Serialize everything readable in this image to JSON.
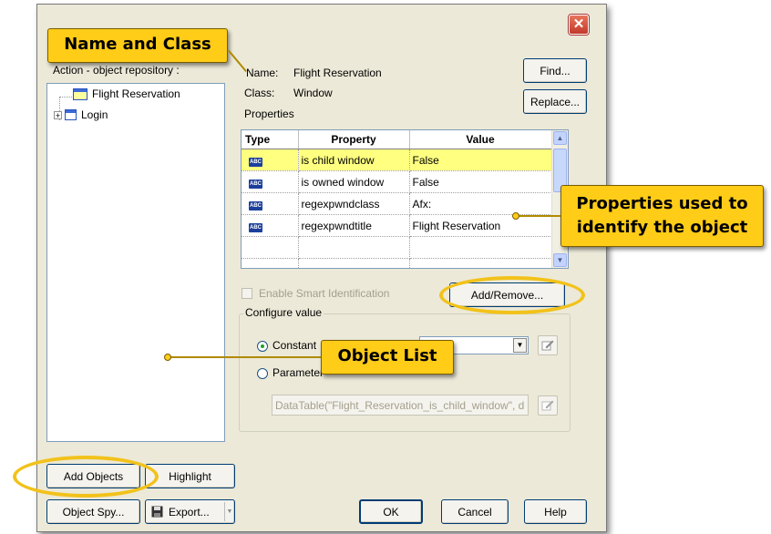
{
  "dialog": {
    "close_glyph": "✕",
    "action_label": "Action - object repository :",
    "name_label": "Name:",
    "name_value": "Flight Reservation",
    "class_label": "Class:",
    "class_value": "Window",
    "properties_label": "Properties"
  },
  "tree": {
    "items": [
      {
        "label": "Flight Reservation",
        "icon": "window-icon"
      },
      {
        "label": "Login",
        "icon": "dialog-icon",
        "expander": "+"
      }
    ]
  },
  "properties_table": {
    "headers": [
      "Type",
      "Property",
      "Value"
    ],
    "rows": [
      {
        "type": "ABC",
        "property": "is child window",
        "value": "False",
        "selected": true
      },
      {
        "type": "ABC",
        "property": "is owned window",
        "value": "False",
        "selected": false
      },
      {
        "type": "ABC",
        "property": "regexpwndclass",
        "value": "Afx:",
        "selected": false
      },
      {
        "type": "ABC",
        "property": "regexpwndtitle",
        "value": "Flight Reservation",
        "selected": false
      }
    ]
  },
  "buttons": {
    "find": "Find...",
    "replace": "Replace...",
    "add_remove": "Add/Remove...",
    "add_objects": "Add Objects",
    "highlight": "Highlight",
    "object_spy": "Object Spy...",
    "export": "Export...",
    "ok": "OK",
    "cancel": "Cancel",
    "help": "Help"
  },
  "smart_identification": {
    "label": "Enable Smart Identification",
    "checked": false,
    "enabled": false
  },
  "configure_value": {
    "title": "Configure value",
    "constant_label": "Constant",
    "parameter_label": "Parameter",
    "selected": "Constant",
    "datatable_value": "DataTable(\"Flight_Reservation_is_child_window\", d"
  },
  "callouts": {
    "name_and_class": "Name and Class",
    "properties": "Properties used to identify the object",
    "object_list": "Object List"
  },
  "colors": {
    "callout": "#ffcc18",
    "selection": "#ffff80",
    "dialog_bg": "#ece9d8",
    "close": "#c1392b"
  }
}
